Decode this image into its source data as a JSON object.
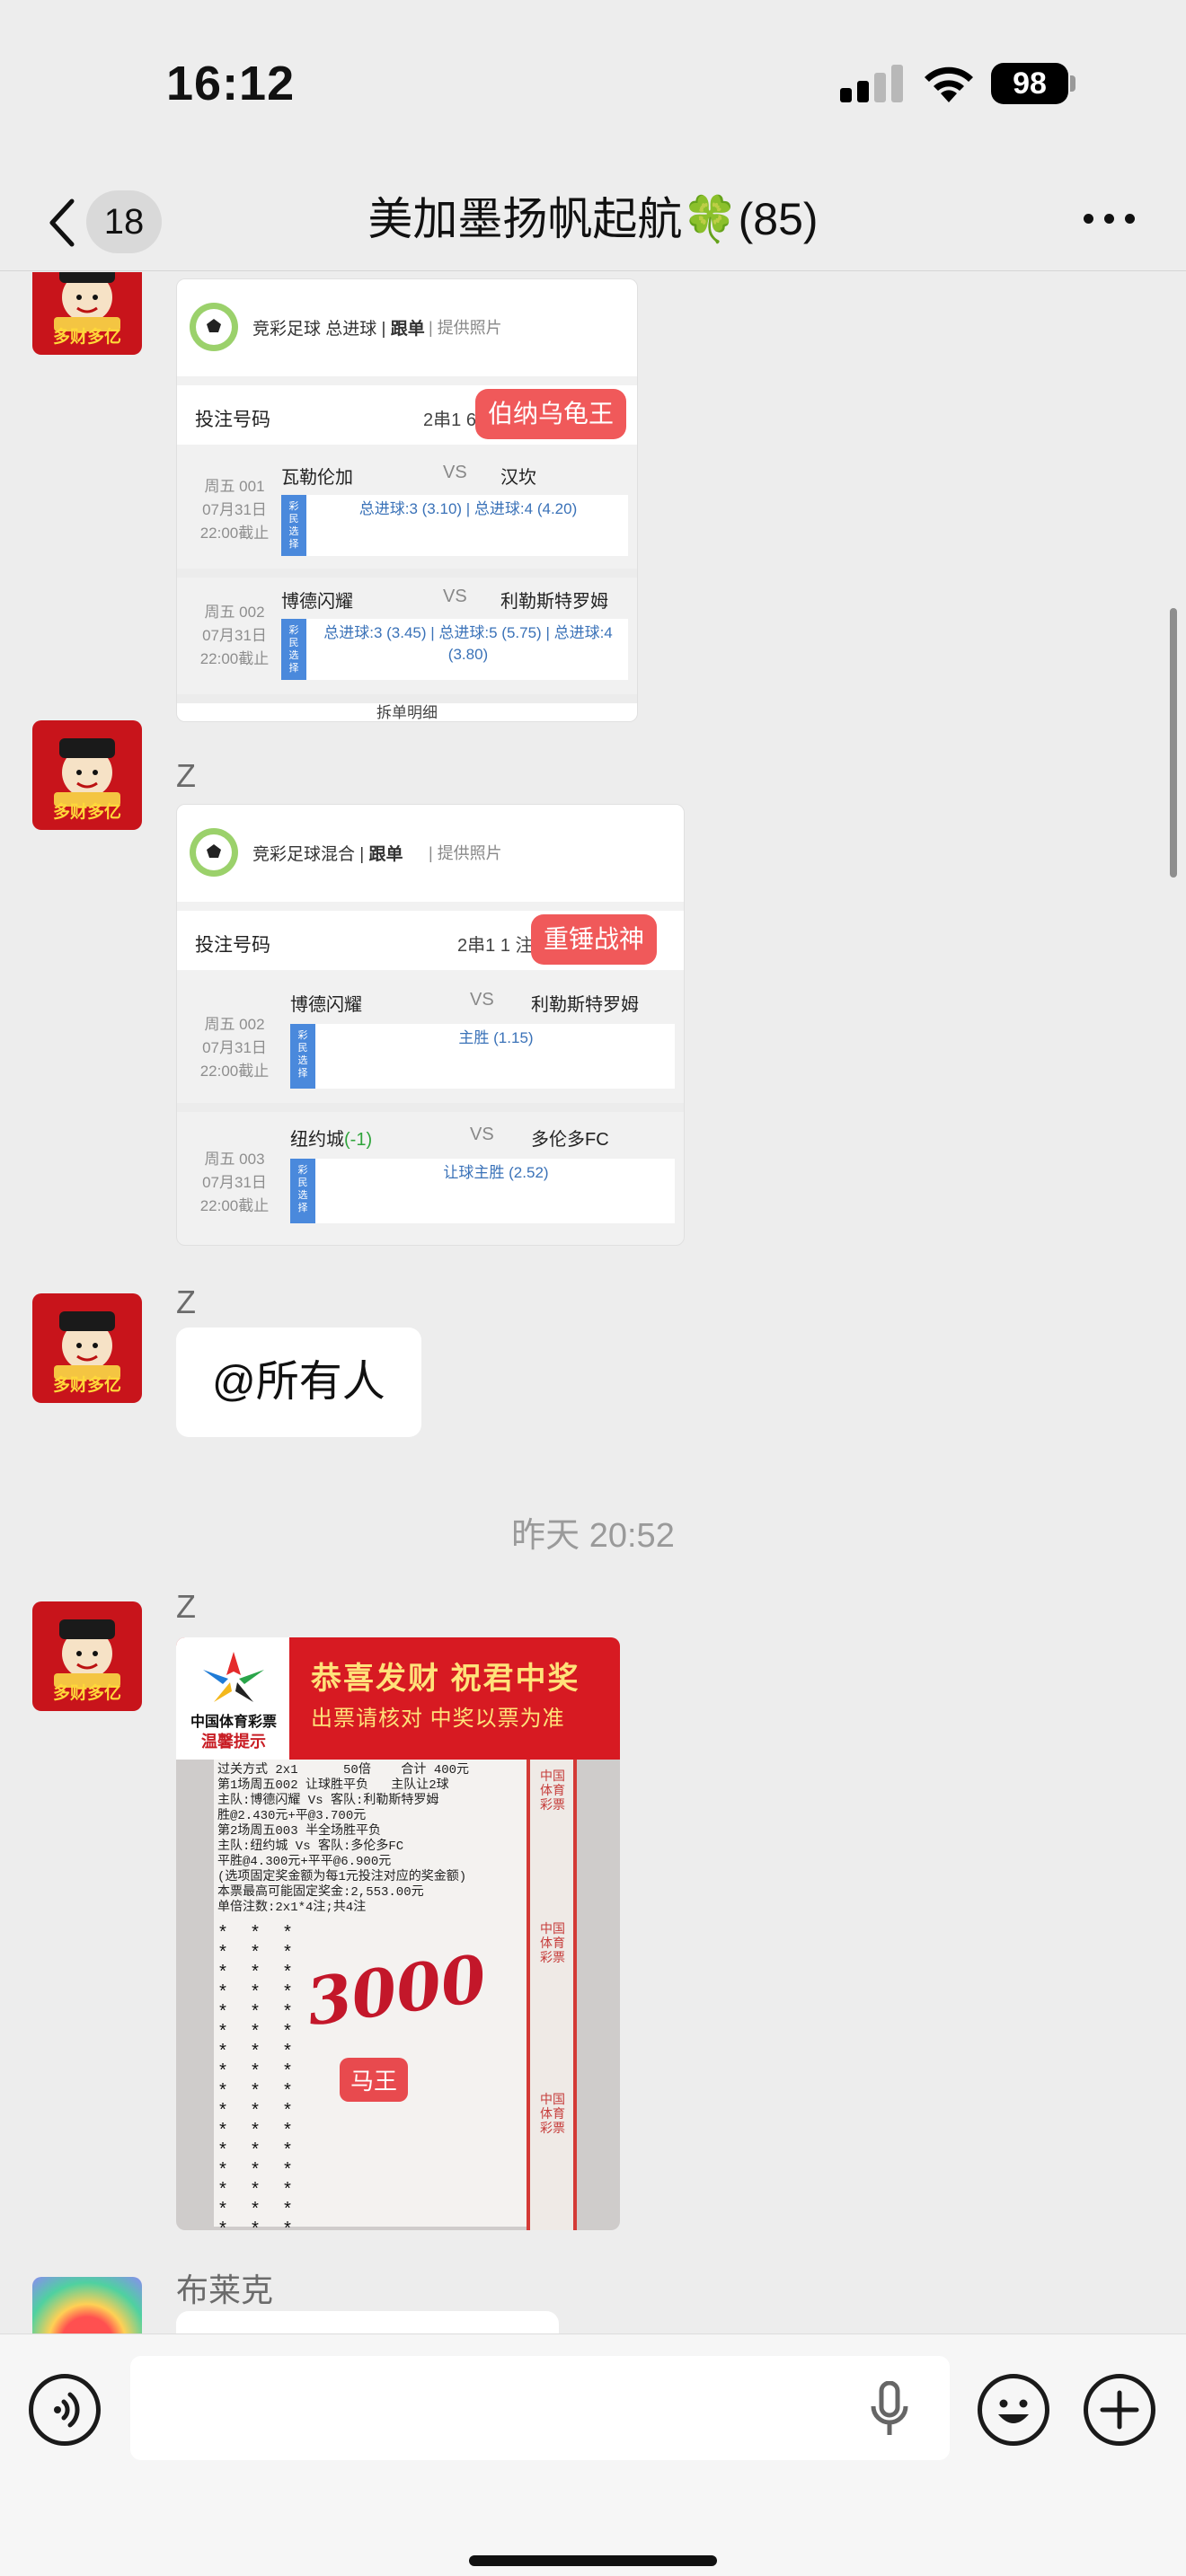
{
  "status_bar": {
    "time": "16:12",
    "battery": "98"
  },
  "nav": {
    "back_count": "18",
    "title": "美加墨扬帆起航🍀(85)"
  },
  "messages": {
    "card1": {
      "game": "竞彩足球 总进球",
      "follow": "跟单",
      "photo": "提供照片",
      "bet_label": "投注号码",
      "pass": "2串1",
      "pass_cut": "6",
      "tag": "伯纳乌龟王",
      "matches": [
        {
          "day": "周五 001",
          "date": "07月31日",
          "deadline": "22:00截止",
          "home": "瓦勒伦加",
          "vs": "VS",
          "away": "汉坎",
          "pick": "总进球:3 (3.10) | 总进球:4 (4.20)"
        },
        {
          "day": "周五 002",
          "date": "07月31日",
          "deadline": "22:00截止",
          "home": "博德闪耀",
          "vs": "VS",
          "away": "利勒斯特罗姆",
          "pick": "总进球:3 (3.45) | 总进球:5 (5.75) | 总进球:4 (3.80)"
        }
      ],
      "split": "拆单明细"
    },
    "card2": {
      "sender": "Z",
      "game": "竞彩足球混合",
      "follow": "跟单",
      "photo": "提供照片",
      "bet_label": "投注号码",
      "pass": "2串1",
      "pass_cut": "1 注",
      "tag": "重锤战神",
      "matches": [
        {
          "day": "周五 002",
          "date": "07月31日",
          "deadline": "22:00截止",
          "home": "博德闪耀",
          "handicap": "",
          "vs": "VS",
          "away": "利勒斯特罗姆",
          "pick": "主胜 (1.15)"
        },
        {
          "day": "周五 003",
          "date": "07月31日",
          "deadline": "22:00截止",
          "home": "纽约城",
          "handicap": "(-1)",
          "vs": "VS",
          "away": "多伦多FC",
          "pick": "让球主胜 (2.52)"
        }
      ]
    },
    "text1": {
      "sender": "Z",
      "text": "@所有人"
    },
    "time_divider": "昨天 20:52",
    "image1": {
      "sender": "Z",
      "lottery_name": "中国体育彩票",
      "reminder": "温馨提示",
      "congrats": "恭喜发财 祝君中奖",
      "notice": "出票请核对 中奖以票为准",
      "lines": "过关方式 2x1      50倍    合计 400元\n第1场周五002 让球胜平负   主队让2球\n主队:博德闪耀 Vs 客队:利勒斯特罗姆\n胜@2.430元+平@3.700元\n第2场周五003 半全场胜平负\n主队:纽约城 Vs 客队:多伦多FC\n平胜@4.300元+平平@6.900元\n(选项固定奖金额为每1元投注对应的奖金额)\n本票最高可能固定奖金:2,553.00元\n单倍注数:2x1*4注;共4注",
      "stars": "*  *  *\n*  *  *\n*  *  *\n*  *  *\n*  *  *\n*  *  *\n*  *  *\n*  *  *\n*  *  *\n*  *  *\n*  *  *\n*  *  *\n*  *  *\n*  *  *\n*  *  *\n*  *  *",
      "strip_text": "中国体育彩票",
      "handwriting": "3000",
      "tag": "马王"
    },
    "last_sender": "布莱克"
  },
  "avatar_caption": "多财多亿",
  "colors": {
    "tag_red": "#f0595a",
    "pick_blue": "#3a72b8",
    "background": "#ededed"
  }
}
